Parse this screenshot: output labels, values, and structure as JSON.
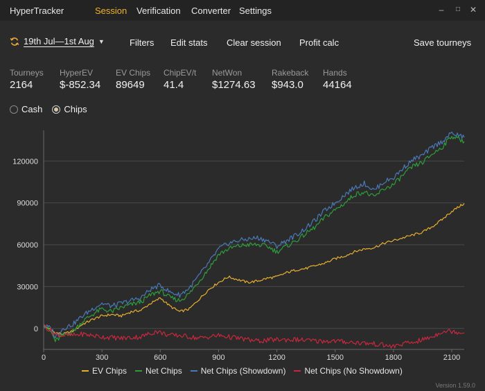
{
  "app": {
    "title": "HyperTracker",
    "menu": [
      "Session",
      "Verification",
      "Converter",
      "Settings"
    ],
    "active_menu": "Session",
    "window_controls": [
      "minimize-icon",
      "maximize-icon",
      "close-icon"
    ]
  },
  "toolbar": {
    "date_range": "19th Jul—1st Aug",
    "filters": "Filters",
    "edit_stats": "Edit stats",
    "clear_session": "Clear session",
    "profit_calc": "Profit calc",
    "save_tourneys": "Save tourneys"
  },
  "stats": [
    {
      "label": "Tourneys",
      "value": "2164"
    },
    {
      "label": "HyperEV",
      "value": "$-852.34"
    },
    {
      "label": "EV Chips",
      "value": "89649"
    },
    {
      "label": "ChipEV/t",
      "value": "41.4"
    },
    {
      "label": "NetWon",
      "value": "$1274.63"
    },
    {
      "label": "Rakeback",
      "value": "$943.0"
    },
    {
      "label": "Hands",
      "value": "44164"
    }
  ],
  "mode": {
    "options": [
      "Cash",
      "Chips"
    ],
    "selected": "Chips"
  },
  "chart_data": {
    "type": "line",
    "xlim": [
      0,
      2164
    ],
    "ylim": [
      -15000,
      142000
    ],
    "x_ticks": [
      0,
      300,
      600,
      900,
      1200,
      1500,
      1800,
      2100
    ],
    "y_ticks": [
      0,
      30000,
      60000,
      90000,
      120000
    ],
    "grid": true,
    "legend_position": "bottom",
    "series": [
      {
        "name": "EV Chips",
        "color": "#e8b030",
        "points": [
          [
            0,
            2000
          ],
          [
            60,
            -3000
          ],
          [
            100,
            -4000
          ],
          [
            150,
            -2000
          ],
          [
            200,
            3000
          ],
          [
            260,
            7000
          ],
          [
            300,
            9000
          ],
          [
            350,
            10000
          ],
          [
            400,
            9000
          ],
          [
            450,
            12000
          ],
          [
            500,
            13000
          ],
          [
            550,
            18000
          ],
          [
            580,
            20000
          ],
          [
            600,
            22000
          ],
          [
            650,
            16000
          ],
          [
            700,
            12000
          ],
          [
            750,
            14000
          ],
          [
            800,
            21000
          ],
          [
            850,
            28000
          ],
          [
            900,
            33000
          ],
          [
            950,
            37000
          ],
          [
            1000,
            35000
          ],
          [
            1050,
            33000
          ],
          [
            1100,
            34000
          ],
          [
            1150,
            36000
          ],
          [
            1200,
            37000
          ],
          [
            1250,
            40000
          ],
          [
            1300,
            42000
          ],
          [
            1350,
            43000
          ],
          [
            1400,
            45000
          ],
          [
            1450,
            47000
          ],
          [
            1500,
            50000
          ],
          [
            1550,
            52000
          ],
          [
            1600,
            55000
          ],
          [
            1650,
            57000
          ],
          [
            1700,
            58000
          ],
          [
            1750,
            61000
          ],
          [
            1800,
            63000
          ],
          [
            1850,
            65000
          ],
          [
            1900,
            67000
          ],
          [
            1950,
            69000
          ],
          [
            2000,
            73000
          ],
          [
            2050,
            78000
          ],
          [
            2100,
            84000
          ],
          [
            2164,
            89649
          ]
        ]
      },
      {
        "name": "Net Chips",
        "color": "#2e9e3a",
        "points": [
          [
            0,
            3000
          ],
          [
            40,
            -3000
          ],
          [
            60,
            -9000
          ],
          [
            100,
            -5000
          ],
          [
            150,
            -2000
          ],
          [
            200,
            5000
          ],
          [
            250,
            10000
          ],
          [
            300,
            14000
          ],
          [
            350,
            12000
          ],
          [
            400,
            15000
          ],
          [
            450,
            17000
          ],
          [
            500,
            19000
          ],
          [
            550,
            24000
          ],
          [
            600,
            27000
          ],
          [
            650,
            22000
          ],
          [
            700,
            20000
          ],
          [
            750,
            25000
          ],
          [
            800,
            34000
          ],
          [
            850,
            43000
          ],
          [
            900,
            53000
          ],
          [
            950,
            57000
          ],
          [
            1000,
            59000
          ],
          [
            1050,
            60000
          ],
          [
            1100,
            60000
          ],
          [
            1150,
            59000
          ],
          [
            1200,
            55000
          ],
          [
            1250,
            59000
          ],
          [
            1300,
            63000
          ],
          [
            1350,
            68000
          ],
          [
            1400,
            73000
          ],
          [
            1450,
            80000
          ],
          [
            1500,
            85000
          ],
          [
            1550,
            90000
          ],
          [
            1600,
            96000
          ],
          [
            1650,
            98000
          ],
          [
            1700,
            94000
          ],
          [
            1750,
            100000
          ],
          [
            1800,
            103000
          ],
          [
            1850,
            110000
          ],
          [
            1900,
            116000
          ],
          [
            1950,
            119000
          ],
          [
            2000,
            125000
          ],
          [
            2050,
            130000
          ],
          [
            2100,
            138000
          ],
          [
            2164,
            134000
          ]
        ]
      },
      {
        "name": "Net Chips (Showdown)",
        "color": "#4a7ab8",
        "points": [
          [
            0,
            2000
          ],
          [
            40,
            0
          ],
          [
            60,
            -6000
          ],
          [
            100,
            0
          ],
          [
            150,
            3000
          ],
          [
            200,
            9000
          ],
          [
            250,
            14000
          ],
          [
            300,
            18000
          ],
          [
            350,
            16000
          ],
          [
            400,
            18000
          ],
          [
            450,
            20000
          ],
          [
            500,
            22000
          ],
          [
            550,
            28000
          ],
          [
            600,
            31000
          ],
          [
            650,
            26000
          ],
          [
            700,
            24000
          ],
          [
            750,
            29000
          ],
          [
            800,
            38000
          ],
          [
            850,
            47000
          ],
          [
            900,
            57000
          ],
          [
            950,
            61000
          ],
          [
            1000,
            63000
          ],
          [
            1050,
            64000
          ],
          [
            1100,
            65000
          ],
          [
            1150,
            63000
          ],
          [
            1200,
            59000
          ],
          [
            1250,
            63000
          ],
          [
            1300,
            67000
          ],
          [
            1350,
            72000
          ],
          [
            1400,
            78000
          ],
          [
            1450,
            85000
          ],
          [
            1500,
            90000
          ],
          [
            1550,
            96000
          ],
          [
            1600,
            101000
          ],
          [
            1650,
            104000
          ],
          [
            1700,
            99000
          ],
          [
            1750,
            105000
          ],
          [
            1800,
            108000
          ],
          [
            1850,
            115000
          ],
          [
            1900,
            121000
          ],
          [
            1950,
            124000
          ],
          [
            2000,
            130000
          ],
          [
            2050,
            134000
          ],
          [
            2100,
            140000
          ],
          [
            2164,
            137000
          ]
        ]
      },
      {
        "name": "Net Chips (No Showdown)",
        "color": "#c8283e",
        "points": [
          [
            0,
            2000
          ],
          [
            60,
            -4000
          ],
          [
            100,
            -5000
          ],
          [
            150,
            -5000
          ],
          [
            200,
            -4000
          ],
          [
            300,
            -6000
          ],
          [
            400,
            -7000
          ],
          [
            500,
            -6000
          ],
          [
            580,
            -2000
          ],
          [
            650,
            -5000
          ],
          [
            700,
            -5000
          ],
          [
            800,
            -7000
          ],
          [
            900,
            -5000
          ],
          [
            1000,
            -7000
          ],
          [
            1100,
            -9000
          ],
          [
            1200,
            -8000
          ],
          [
            1300,
            -8000
          ],
          [
            1400,
            -9000
          ],
          [
            1500,
            -9000
          ],
          [
            1600,
            -10000
          ],
          [
            1700,
            -11000
          ],
          [
            1750,
            -12000
          ],
          [
            1800,
            -13000
          ],
          [
            1850,
            -11000
          ],
          [
            1900,
            -10000
          ],
          [
            1950,
            -8000
          ],
          [
            2000,
            -6000
          ],
          [
            2050,
            -2000
          ],
          [
            2100,
            -2000
          ],
          [
            2164,
            -3000
          ]
        ]
      }
    ]
  },
  "version": "Version 1.59.0"
}
